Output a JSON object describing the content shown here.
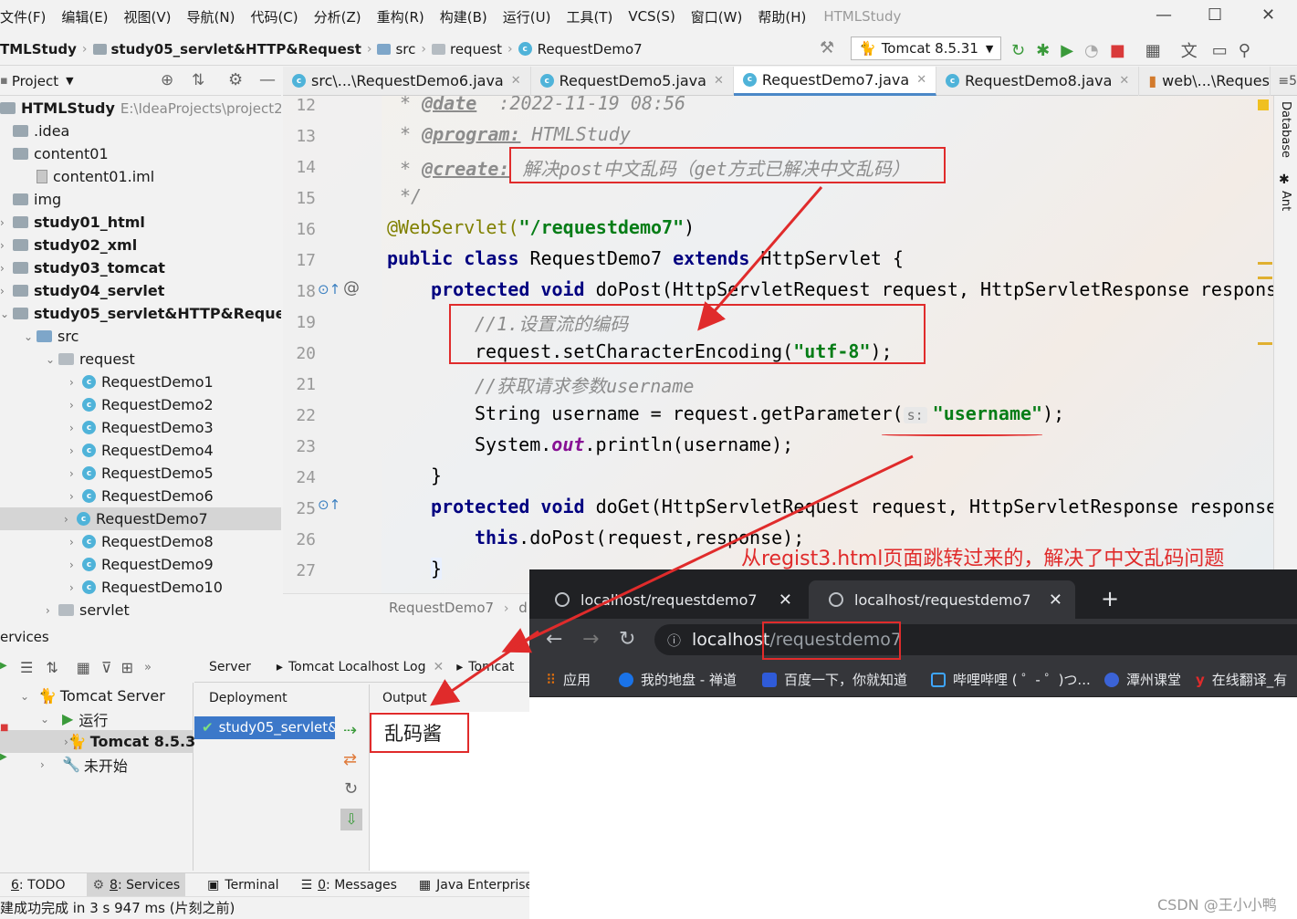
{
  "menu": [
    "文件(F)",
    "编辑(E)",
    "视图(V)",
    "导航(N)",
    "代码(C)",
    "分析(Z)",
    "重构(R)",
    "构建(B)",
    "运行(U)",
    "工具(T)",
    "VCS(S)",
    "窗口(W)",
    "帮助(H)"
  ],
  "app_title": "HTMLStudy",
  "window_controls": {
    "minimize": "—",
    "maximize": "☐",
    "close": "✕"
  },
  "breadcrumb": {
    "project": "TMLStudy",
    "module": "study05_servlet&HTTP&Request",
    "src": "src",
    "pkg": "request",
    "cls": "RequestDemo7"
  },
  "run_config": "Tomcat 8.5.31",
  "project_panel": {
    "title": "Project",
    "root": "HTMLStudy",
    "root_path": "E:\\IdeaProjects\\project2\\H"
  },
  "tree": [
    {
      "label": ".idea",
      "kind": "folder"
    },
    {
      "label": "content01",
      "kind": "folder"
    },
    {
      "label": "content01.iml",
      "kind": "file"
    },
    {
      "label": "img",
      "kind": "folder"
    },
    {
      "label": "study01_html",
      "kind": "module"
    },
    {
      "label": "study02_xml",
      "kind": "module"
    },
    {
      "label": "study03_tomcat",
      "kind": "module"
    },
    {
      "label": "study04_servlet",
      "kind": "module"
    },
    {
      "label": "study05_servlet&HTTP&Request",
      "kind": "module"
    },
    {
      "label": "src",
      "kind": "src"
    },
    {
      "label": "request",
      "kind": "pkg"
    },
    {
      "label": "RequestDemo1",
      "kind": "class"
    },
    {
      "label": "RequestDemo2",
      "kind": "class"
    },
    {
      "label": "RequestDemo3",
      "kind": "class"
    },
    {
      "label": "RequestDemo4",
      "kind": "class"
    },
    {
      "label": "RequestDemo5",
      "kind": "class"
    },
    {
      "label": "RequestDemo6",
      "kind": "class"
    },
    {
      "label": "RequestDemo7",
      "kind": "class",
      "selected": true
    },
    {
      "label": "RequestDemo8",
      "kind": "class"
    },
    {
      "label": "RequestDemo9",
      "kind": "class"
    },
    {
      "label": "RequestDemo10",
      "kind": "class"
    },
    {
      "label": "servlet",
      "kind": "pkg"
    }
  ],
  "editor_tabs": [
    "src\\...\\RequestDemo6.java",
    "RequestDemo5.java",
    "RequestDemo7.java",
    "RequestDemo8.java",
    "web\\...\\RequestI"
  ],
  "active_tab": 2,
  "tab_overflow": "≡5",
  "line_numbers": [
    "12",
    "13",
    "14",
    "15",
    "16",
    "17",
    "18",
    "19",
    "20",
    "21",
    "22",
    "23",
    "24",
    "25",
    "26",
    "27"
  ],
  "code": {
    "l12_tag": "@date",
    "l12_val": "  :2022-11-19 08:56",
    "l13_tag": "@program:",
    "l13_val": " HTMLStudy",
    "l14_tag": "@create:",
    "l14_val": "解决post中文乱码（get方式已解决中文乱码）",
    "l15": "*/",
    "l16_ann": "@WebServlet(",
    "l16_str": "\"/requestdemo7\"",
    "l16_end": ")",
    "l17_kw1": "public class",
    "l17_mid": " RequestDemo7 ",
    "l17_kw2": "extends",
    "l17_end": " HttpServlet {",
    "l18_kw": "protected void",
    "l18_rest": " doPost(HttpServletRequest request, HttpServletResponse respons",
    "l19_cm": "//1.设置流的编码",
    "l20_a": "request.setCharacterEncoding(",
    "l20_str": "\"utf-8\"",
    "l20_b": ");",
    "l21_cm": "//获取请求参数username",
    "l22_a": "String username = request.getParameter(",
    "l22_hint": "s:",
    "l22_str": "\"username\"",
    "l22_b": ");",
    "l23_a": "System.",
    "l23_fld": "out",
    "l23_b": ".println(username);",
    "l24": "}",
    "l25_kw": "protected void",
    "l25_rest": " doGet(HttpServletRequest request, HttpServletResponse response",
    "l26_kw": "this",
    "l26_rest": ".doPost(request,response);",
    "l27": "}"
  },
  "editor_breadcrumb": [
    "RequestDemo7",
    "d"
  ],
  "right_strip": [
    "Database",
    "Ant"
  ],
  "services": {
    "title": "ervices",
    "tree": [
      {
        "label": "Tomcat Server"
      },
      {
        "label": "运行"
      },
      {
        "label": "Tomcat 8.5.3",
        "selected": true
      },
      {
        "label": "未开始"
      }
    ],
    "subtabs": [
      "Server",
      "Tomcat Localhost Log",
      "Tomcat"
    ],
    "deployment_header": "Deployment",
    "output_header": "Output",
    "deployment_item": "study05_servlet&",
    "output_text": "乱码酱"
  },
  "bottom_tabs": [
    {
      "key": "6",
      "label": ": TODO"
    },
    {
      "key": "8",
      "label": ": Services",
      "active": true
    },
    {
      "key": "",
      "label": "Terminal"
    },
    {
      "key": "0",
      "label": ": Messages"
    },
    {
      "key": "",
      "label": "Java Enterprise"
    }
  ],
  "status": "建成功完成 in 3 s 947 ms (片刻之前)",
  "browser": {
    "tabs": [
      "localhost/requestdemo7",
      "localhost/requestdemo7"
    ],
    "new_tab": "+",
    "url_host": "localhost",
    "url_path": "/requestdemo7",
    "bookmarks": [
      "应用",
      "我的地盘 - 禅道",
      "百度一下，你就知道",
      "哔哩哔哩 ( ゜- ゜)つ...",
      "潭州课堂",
      "在线翻译_有"
    ]
  },
  "annotation": "从regist3.html页面跳转过来的，解决了中文乱码问题",
  "watermark": "CSDN @王小小鸭",
  "colors": {
    "accent": "#4a88c7",
    "annotation_red": "#e02b2b",
    "keyword": "#000080",
    "string": "#067d17"
  }
}
